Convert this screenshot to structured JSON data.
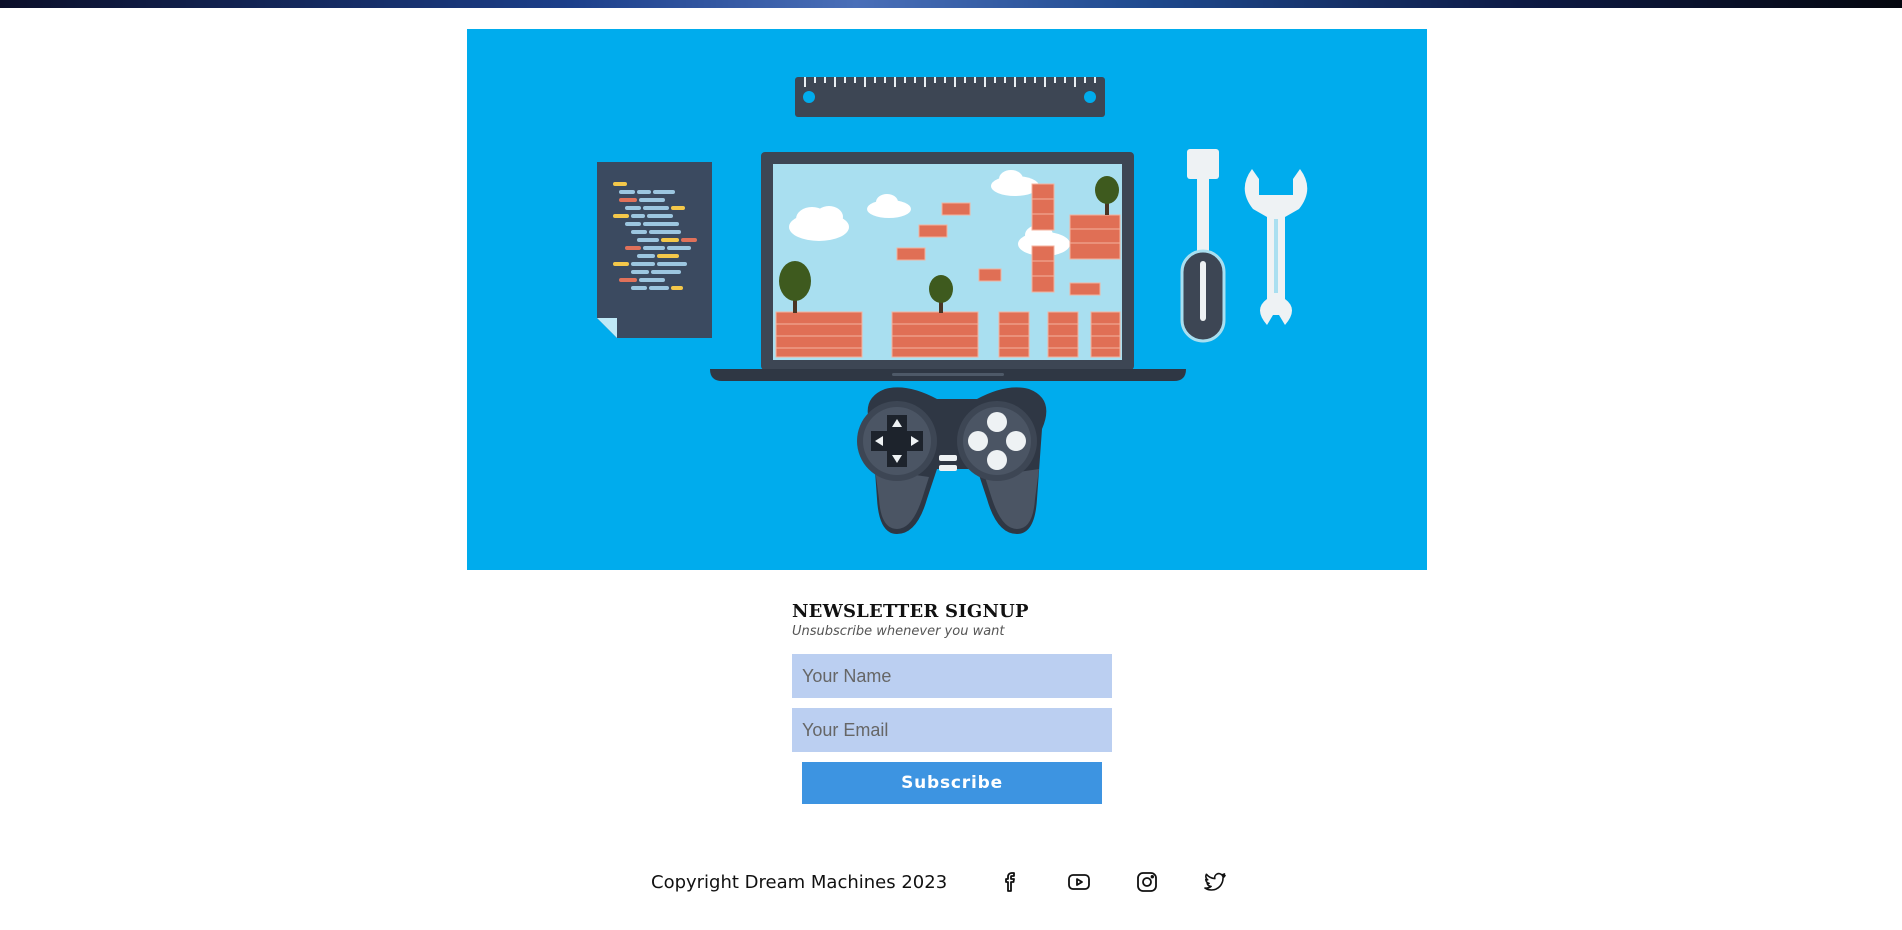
{
  "hero": {
    "image_description_icon": "game-dev-illustration",
    "background_color": "#00aced"
  },
  "newsletter": {
    "title": "NEWSLETTER SIGNUP",
    "subtitle": "Unsubscribe whenever you want",
    "name_placeholder": "Your Name",
    "email_placeholder": "Your Email",
    "subscribe_label": "Subscribe",
    "input_color": "#bbcff1",
    "button_color": "#3d94e1"
  },
  "footer": {
    "copyright": "Copyright Dream Machines 2023",
    "social": [
      {
        "icon": "facebook-icon"
      },
      {
        "icon": "youtube-icon"
      },
      {
        "icon": "instagram-icon"
      },
      {
        "icon": "twitter-icon"
      }
    ]
  }
}
